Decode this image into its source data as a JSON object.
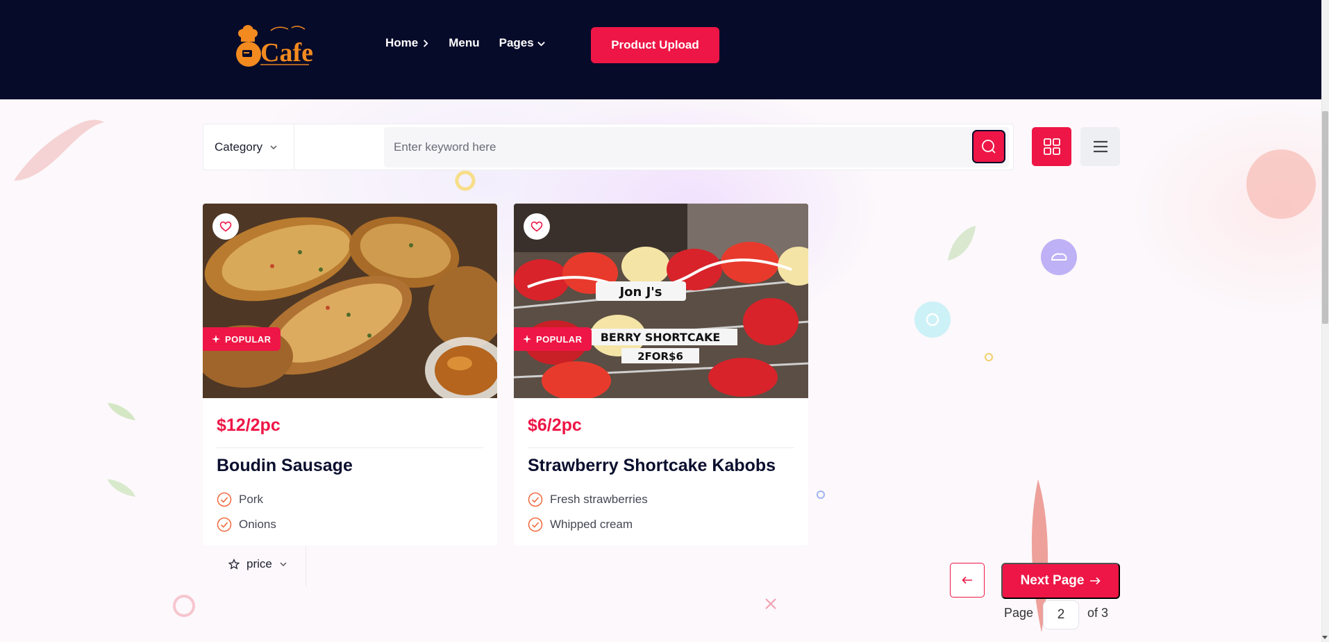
{
  "header": {
    "logo_text": "Cafe",
    "nav": [
      {
        "label": "Home",
        "icon": "chevron-right-icon"
      },
      {
        "label": "Menu",
        "icon": ""
      },
      {
        "label": "Pages",
        "icon": "chevron-down-icon"
      }
    ],
    "upload_label": "Product Upload"
  },
  "filters": {
    "category_label": "Category",
    "price_label": "price",
    "search_placeholder": "Enter keyword here",
    "search_value": ""
  },
  "products": [
    {
      "price": "$12/2pc",
      "name": "Boudin Sausage",
      "badge": "POPULAR",
      "ingredients": [
        "Pork",
        "Onions"
      ]
    },
    {
      "price": "$6/2pc",
      "name": "Strawberry Shortcake Kabobs",
      "badge": "POPULAR",
      "ingredients": [
        "Fresh strawberries",
        "Whipped cream"
      ],
      "image_text": [
        "Jon J's",
        "BERRY SHORTCAKE",
        "2FOR$6"
      ]
    }
  ],
  "pagination": {
    "next_label": "Next Page",
    "page_label": "Page",
    "current_page": "2",
    "of_label": "of 3"
  },
  "colors": {
    "accent": "#ee1646",
    "header_bg": "#070b2a"
  }
}
